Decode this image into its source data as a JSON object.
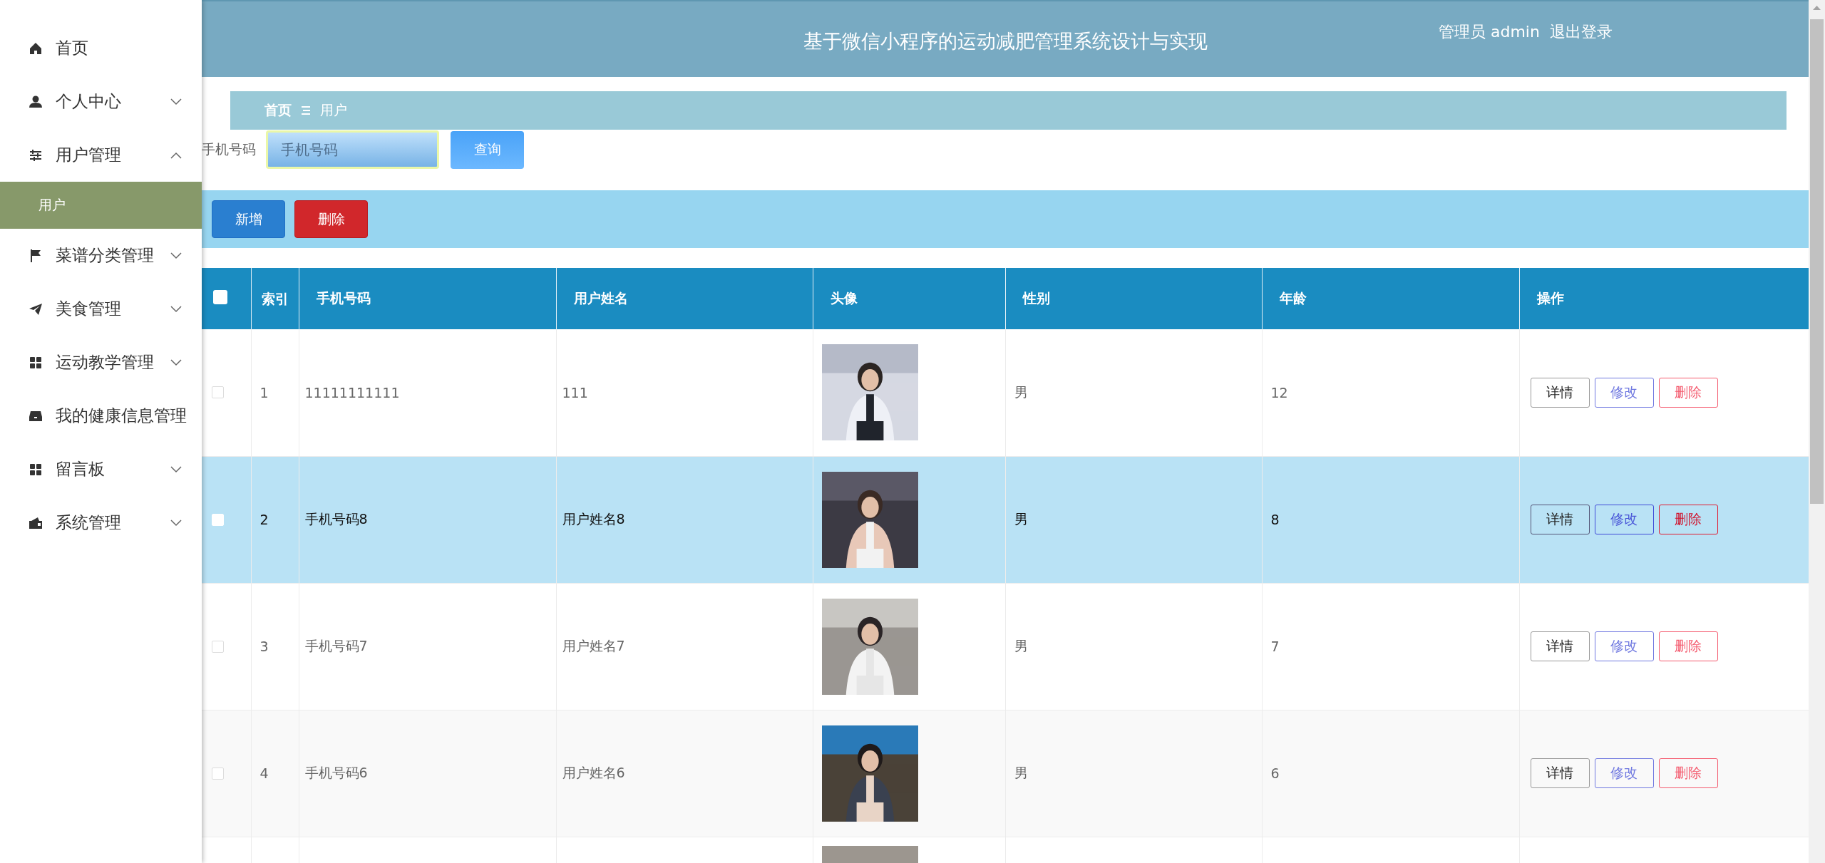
{
  "sidebar": {
    "items": [
      {
        "label": "首页"
      },
      {
        "label": "个人中心",
        "expanded": false
      },
      {
        "label": "用户管理",
        "expanded": true,
        "children": [
          {
            "label": "用户",
            "selected": true
          }
        ]
      },
      {
        "label": "菜谱分类管理",
        "expanded": false
      },
      {
        "label": "美食管理",
        "expanded": false
      },
      {
        "label": "运动教学管理",
        "expanded": false
      },
      {
        "label": "我的健康信息管理"
      },
      {
        "label": "留言板",
        "expanded": false
      },
      {
        "label": "系统管理",
        "expanded": false
      }
    ]
  },
  "header": {
    "title": "基于微信小程序的运动减肥管理系统设计与实现",
    "user": "管理员 admin",
    "logout": "退出登录"
  },
  "breadcrumb": [
    "首页",
    "用户"
  ],
  "search": {
    "label": "手机号码",
    "placeholder": "手机号码",
    "button": "查询"
  },
  "toolbar": {
    "add": "新增",
    "delete": "删除"
  },
  "table": {
    "select_all": {
      "checked": false
    },
    "columns": [
      "索引",
      "手机号码",
      "用户姓名",
      "头像",
      "性别",
      "年龄",
      "操作"
    ],
    "rows": [
      {
        "checked": false,
        "hovered": false,
        "index": "1",
        "phone": "11111111111",
        "name": "111",
        "avatar": {
          "kind": "picture"
        },
        "sex": "男",
        "age": "12",
        "actions": [
          "详情",
          "修改",
          "删除"
        ]
      },
      {
        "checked": false,
        "hovered": true,
        "index": "2",
        "phone": "手机号码8",
        "name": "用户姓名8",
        "avatar": {
          "kind": "picture"
        },
        "sex": "男",
        "age": "8",
        "actions": [
          "详情",
          "修改",
          "删除"
        ]
      },
      {
        "checked": false,
        "hovered": false,
        "index": "3",
        "phone": "手机号码7",
        "name": "用户姓名7",
        "avatar": {
          "kind": "picture"
        },
        "sex": "男",
        "age": "7",
        "actions": [
          "详情",
          "修改",
          "删除"
        ]
      },
      {
        "checked": false,
        "hovered": false,
        "index": "4",
        "phone": "手机号码6",
        "name": "用户姓名6",
        "avatar": {
          "kind": "picture"
        },
        "sex": "男",
        "age": "6",
        "actions": [
          "详情",
          "修改",
          "删除"
        ]
      },
      {
        "avatar": {
          "kind": "picture"
        }
      }
    ]
  }
}
